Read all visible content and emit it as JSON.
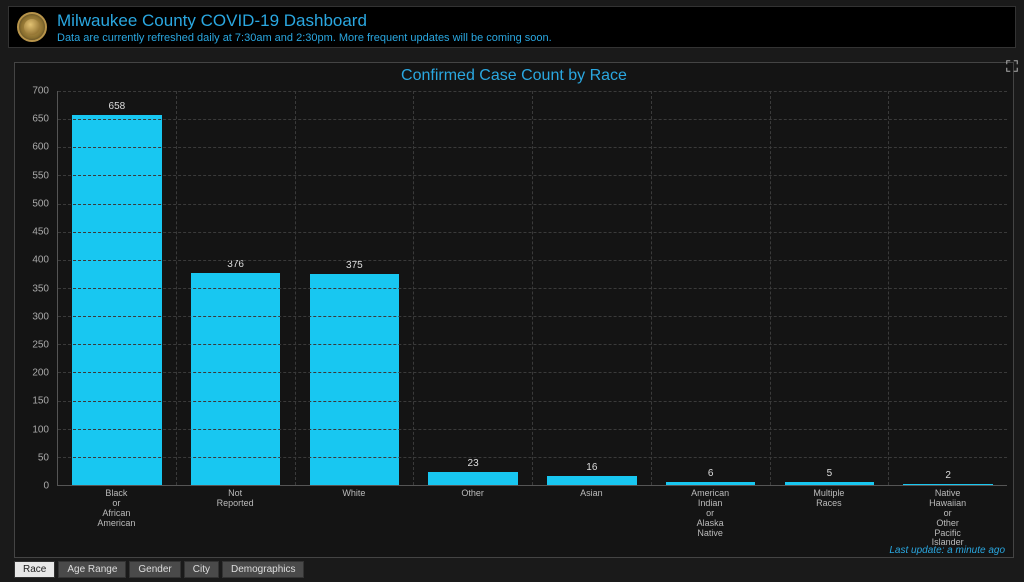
{
  "header": {
    "title": "Milwaukee County COVID-19 Dashboard",
    "subtitle": "Data are currently refreshed daily at 7:30am and 2:30pm. More frequent updates will be coming soon."
  },
  "chart_data": {
    "type": "bar",
    "title": "Confirmed Case Count by Race",
    "categories": [
      "Black\nor\nAfrican\nAmerican",
      "Not\nReported",
      "White",
      "Other",
      "Asian",
      "American\nIndian\nor\nAlaska\nNative",
      "Multiple\nRaces",
      "Native\nHawaiian\nor\nOther\nPacific\nIslander"
    ],
    "values": [
      658,
      376,
      375,
      23,
      16,
      6,
      5,
      2
    ],
    "ylim": [
      0,
      700
    ],
    "ystep": 50,
    "xlabel": "",
    "ylabel": ""
  },
  "footer": {
    "last_update": "Last update: a minute ago"
  },
  "tabs": {
    "items": [
      "Race",
      "Age Range",
      "Gender",
      "City",
      "Demographics"
    ],
    "active_index": 0
  },
  "colors": {
    "bar": "#18c7f1",
    "accent": "#2aa7e0"
  }
}
